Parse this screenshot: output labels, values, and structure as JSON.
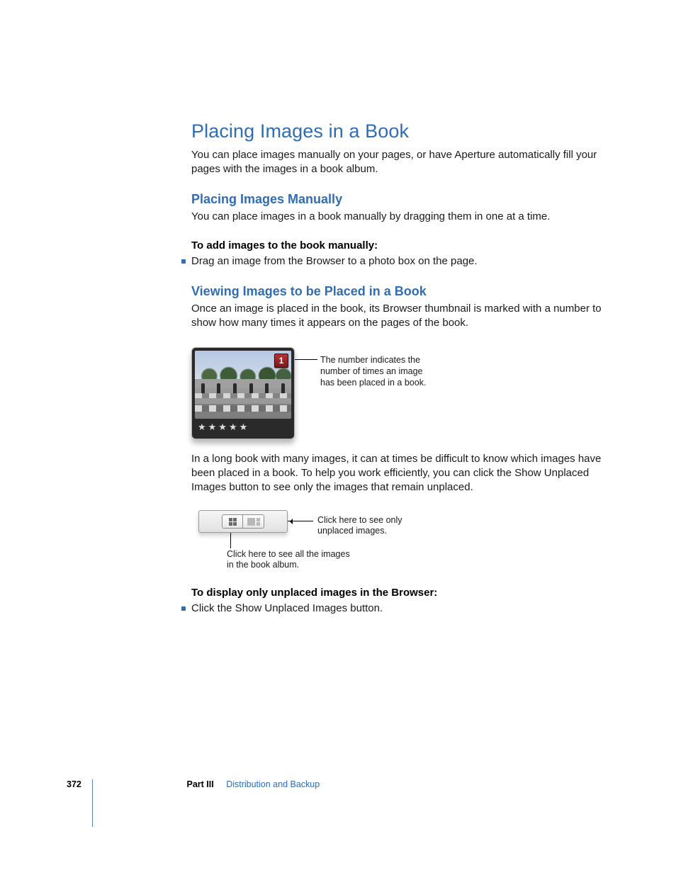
{
  "title": "Placing Images in a Book",
  "intro": "You can place images manually on your pages, or have Aperture automatically fill your pages with the images in a book album.",
  "section1": {
    "heading": "Placing Images Manually",
    "body": "You can place images in a book manually by dragging them in one at a time.",
    "task": "To add images to the book manually:",
    "bullet": "Drag an image from the Browser to a photo box on the page."
  },
  "section2": {
    "heading": "Viewing Images to be Placed in a Book",
    "body1": "Once an image is placed in the book, its Browser thumbnail is marked with a number to show how many times it appears on the pages of the book.",
    "badge_value": "1",
    "stars": "★★★★★",
    "callout1": "The number indicates the number of times an image has been placed in a book.",
    "body2": "In a long book with many images, it can at times be difficult to know which images have been placed in a book. To help you work efficiently, you can click the Show Unplaced Images button to see only the images that remain unplaced.",
    "callout_right": "Click here to see only unplaced images.",
    "callout_below": "Click here to see all the images in the book album.",
    "task2": "To display only unplaced images in the Browser:",
    "bullet2": "Click the Show Unplaced Images button."
  },
  "footer": {
    "page": "372",
    "part": "Part III",
    "section": "Distribution and Backup"
  }
}
